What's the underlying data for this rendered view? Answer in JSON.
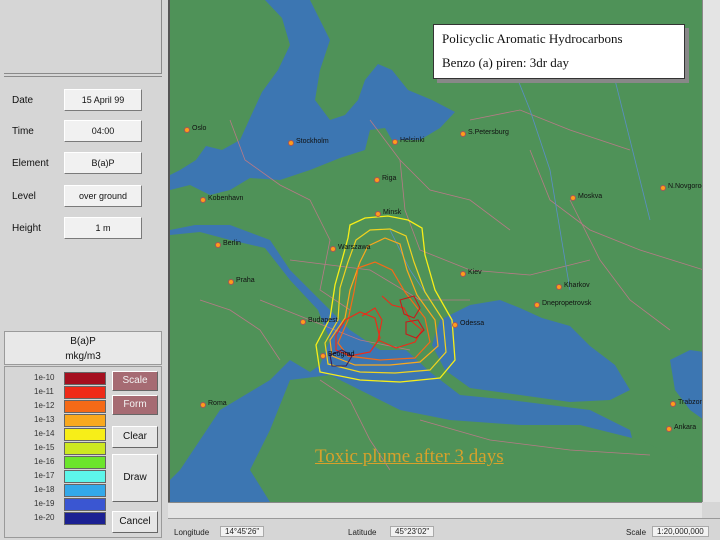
{
  "fields": [
    {
      "label": "Date",
      "value": "15 April 99"
    },
    {
      "label": "Time",
      "value": "04:00"
    },
    {
      "label": "Element",
      "value": "B(a)P"
    },
    {
      "label": "Level",
      "value": "over ground"
    },
    {
      "label": "Height",
      "value": "1 m"
    }
  ],
  "legend": {
    "title1": "B(a)P",
    "title2": "mkg/m3",
    "items": [
      {
        "label": "1e-10",
        "color": "#a50f1f"
      },
      {
        "label": "1e-11",
        "color": "#ef2a18"
      },
      {
        "label": "1e-12",
        "color": "#f56a17"
      },
      {
        "label": "1e-13",
        "color": "#f9a91e"
      },
      {
        "label": "1e-14",
        "color": "#f7ee18"
      },
      {
        "label": "1e-15",
        "color": "#cde821"
      },
      {
        "label": "1e-16",
        "color": "#6ce52c"
      },
      {
        "label": "1e-17",
        "color": "#5df6ea"
      },
      {
        "label": "1e-18",
        "color": "#33a9ea"
      },
      {
        "label": "1e-19",
        "color": "#3a56d2"
      },
      {
        "label": "1e-20",
        "color": "#1b2092"
      }
    ]
  },
  "buttons": {
    "scale": "Scale",
    "form": "Form",
    "clear": "Clear",
    "draw": "Draw",
    "cancel": "Cancel"
  },
  "infobox": {
    "line1": "Policyclic Aromatic Hydrocarbons",
    "line2": "Benzo (a) piren:  3dr day"
  },
  "caption": "Toxic plume after 3 days",
  "cities": [
    "Oslo",
    "Stockholm",
    "Helsinki",
    "S.Petersburg",
    "Riga",
    "Kobenhavn",
    "Minsk",
    "Moskva",
    "N.Novgorod",
    "Berlin",
    "Warszawa",
    "Kiev",
    "Praha",
    "Kharkov",
    "Dnepropetrovsk",
    "Budapest",
    "Odessa",
    "Beograd",
    "Roma",
    "Trabzon",
    "Ankara"
  ],
  "status": {
    "longitude_label": "Longitude",
    "longitude": "14°45'26\"",
    "latitude_label": "Latitude",
    "latitude": "45°23'02\"",
    "scale_label": "Scale",
    "scale": "1:20,000,000"
  },
  "colors": {
    "sea": "#3c76b2",
    "land": "#4f9258",
    "panel": "#d6d6d6",
    "accent_button": "#a66b73"
  }
}
